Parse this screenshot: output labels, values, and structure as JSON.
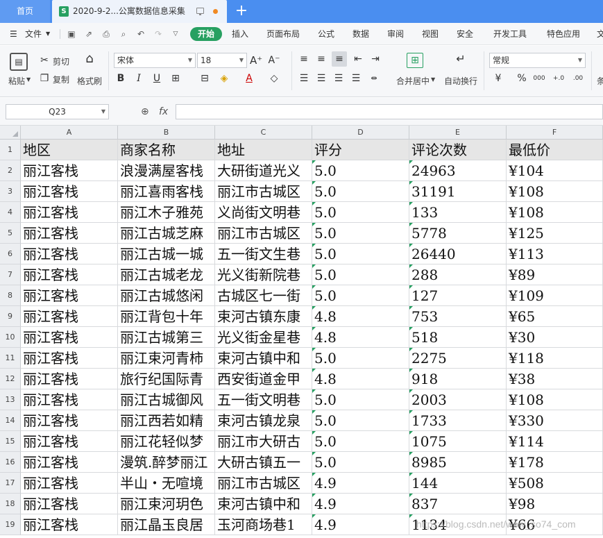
{
  "tabs": {
    "home_label": "首页",
    "doc_title": "2020-9-2...公寓数据信息采集",
    "doc_icon": "S"
  },
  "menu": {
    "file_label": "文件",
    "start_label": "开始",
    "items": [
      "插入",
      "页面布局",
      "公式",
      "数据",
      "审阅",
      "视图",
      "安全",
      "开发工具",
      "特色应用",
      "文"
    ]
  },
  "ribbon": {
    "paste_label": "粘贴",
    "cut_label": "剪切",
    "copy_label": "复制",
    "format_painter_label": "格式刷",
    "font_name": "宋体",
    "font_size": "18",
    "merge_center_label": "合并居中",
    "wrap_text_label": "自动换行",
    "number_format": "常规",
    "cond_label": "条"
  },
  "formula_bar": {
    "cell_ref": "Q23",
    "fx_label": "fx",
    "formula": ""
  },
  "sheet": {
    "columns": [
      "A",
      "B",
      "C",
      "D",
      "E",
      "F"
    ],
    "row_numbers": [
      "1",
      "2",
      "3",
      "4",
      "5",
      "6",
      "7",
      "8",
      "9",
      "10",
      "11",
      "12",
      "13",
      "14",
      "15",
      "16",
      "17",
      "18",
      "19"
    ],
    "header": [
      "地区",
      "商家名称",
      "地址",
      "评分",
      "评论次数",
      "最低价"
    ],
    "rows": [
      [
        "丽江客栈",
        "浪漫满屋客栈",
        "大研街道光义",
        "5.0",
        "24963",
        "¥104"
      ],
      [
        "丽江客栈",
        "丽江喜雨客栈",
        "丽江市古城区",
        "5.0",
        "31191",
        "¥108"
      ],
      [
        "丽江客栈",
        "丽江木子雅苑",
        "义尚街文明巷",
        "5.0",
        "133",
        "¥108"
      ],
      [
        "丽江客栈",
        "丽江古城芝麻",
        "丽江市古城区",
        "5.0",
        "5778",
        "¥125"
      ],
      [
        "丽江客栈",
        "丽江古城一城",
        "五一街文生巷",
        "5.0",
        "26440",
        "¥113"
      ],
      [
        "丽江客栈",
        "丽江古城老龙",
        "光义街新院巷",
        "5.0",
        "288",
        "¥89"
      ],
      [
        "丽江客栈",
        "丽江古城悠闲",
        "古城区七一街",
        "5.0",
        "127",
        "¥109"
      ],
      [
        "丽江客栈",
        "丽江背包十年",
        "束河古镇东康",
        "4.8",
        "753",
        "¥65"
      ],
      [
        "丽江客栈",
        "丽江古城第三",
        "光义街金星巷",
        "4.8",
        "518",
        "¥30"
      ],
      [
        "丽江客栈",
        "丽江束河青柿",
        "束河古镇中和",
        "5.0",
        "2275",
        "¥118"
      ],
      [
        "丽江客栈",
        "旅行纪国际青",
        "西安街道金甲",
        "4.8",
        "918",
        "¥38"
      ],
      [
        "丽江客栈",
        "丽江古城御风",
        "五一街文明巷",
        "5.0",
        "2003",
        "¥108"
      ],
      [
        "丽江客栈",
        "丽江西若如精",
        "束河古镇龙泉",
        "5.0",
        "1733",
        "¥330"
      ],
      [
        "丽江客栈",
        "丽江花轻似梦",
        "丽江市大研古",
        "5.0",
        "1075",
        "¥114"
      ],
      [
        "丽江客栈",
        "漫筑.醉梦丽江",
        "大研古镇五一",
        "5.0",
        "8985",
        "¥178"
      ],
      [
        "丽江客栈",
        "半山・无喧境",
        "丽江市古城区",
        "4.9",
        "144",
        "¥508"
      ],
      [
        "丽江客栈",
        "丽江束河玥色",
        "束河古镇中和",
        "4.9",
        "837",
        "¥98"
      ],
      [
        "丽江客栈",
        "丽江晶玉良居",
        "玉河商场巷1",
        "4.9",
        "1134",
        "¥66"
      ]
    ]
  },
  "watermark": "https://blog.csdn.net/wow_so74_com",
  "colors": {
    "tab_blue": "#4a8ef0",
    "accent_green": "#27a061",
    "header_fill": "#e6e6e6"
  }
}
